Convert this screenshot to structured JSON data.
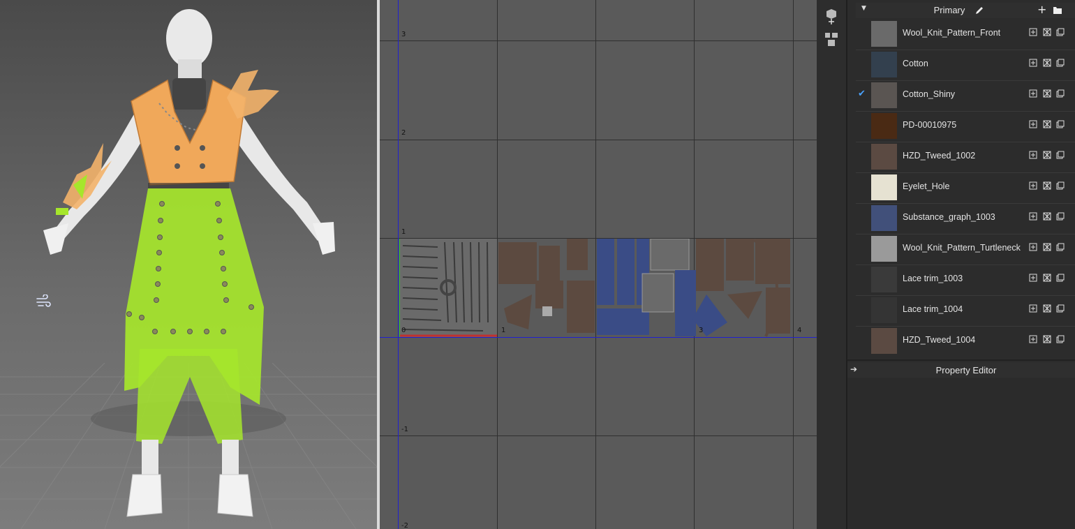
{
  "uv_editor": {
    "axis_labels": {
      "v3": "3",
      "v2": "2",
      "v1": "1",
      "vneg1": "-1",
      "vneg2": "-2",
      "u0": "0",
      "u1": "1",
      "u3": "3",
      "u4": "4"
    }
  },
  "tool_strip": {
    "tools": [
      {
        "icon": "uv-arrange-icon"
      },
      {
        "icon": "garment-pieces-icon"
      }
    ]
  },
  "library": {
    "section_title": "Primary",
    "materials": [
      {
        "name": "Wool_Knit_Pattern_Front",
        "checked": false,
        "thumb_color": "#6a6a6a"
      },
      {
        "name": "Cotton",
        "checked": false,
        "thumb_color": "#33404e"
      },
      {
        "name": "Cotton_Shiny",
        "checked": true,
        "thumb_color": "#5a5552"
      },
      {
        "name": "PD-00010975",
        "checked": false,
        "thumb_color": "#4a2a14"
      },
      {
        "name": "HZD_Tweed_1002",
        "checked": false,
        "thumb_color": "#5b4a42"
      },
      {
        "name": "Eyelet_Hole",
        "checked": false,
        "thumb_color": "#e6e2d2"
      },
      {
        "name": "Substance_graph_1003",
        "checked": false,
        "thumb_color": "#41507a"
      },
      {
        "name": "Wool_Knit_Pattern_Turtleneck",
        "checked": false,
        "thumb_color": "#9a9a9a"
      },
      {
        "name": "Lace trim_1003",
        "checked": false,
        "thumb_color": "#3a3a3a"
      },
      {
        "name": "Lace trim_1004",
        "checked": false,
        "thumb_color": "#343434"
      },
      {
        "name": "HZD_Tweed_1004",
        "checked": false,
        "thumb_color": "#5b4a42"
      }
    ]
  },
  "property_editor": {
    "title": "Property Editor"
  },
  "colors": {
    "check": "#4aa3ff",
    "top_garment": "#f0a85a",
    "skirt_garment": "#a6e62b"
  }
}
